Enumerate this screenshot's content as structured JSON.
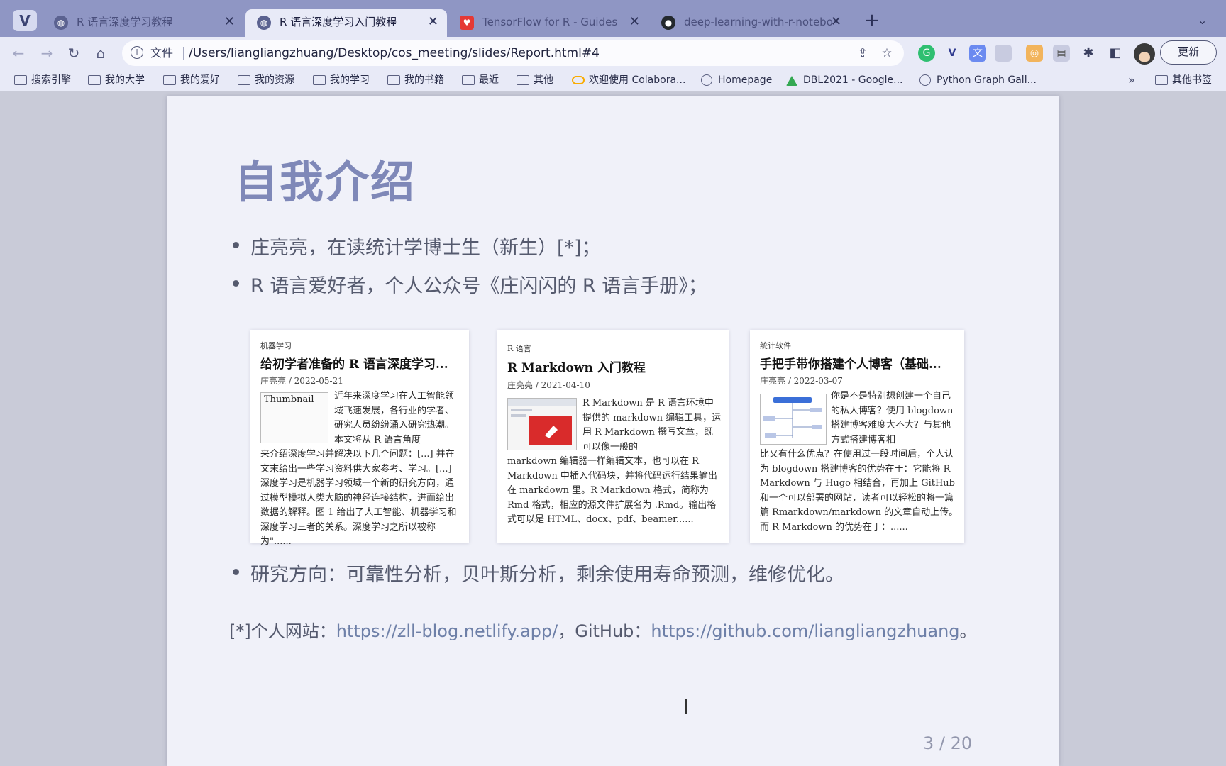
{
  "tabs": [
    {
      "title": "R 语言深度学习教程",
      "favicon": "globe-icon",
      "state": "inactive"
    },
    {
      "title": "R 语言深度学习入门教程",
      "favicon": "globe-icon",
      "state": "active"
    },
    {
      "title": "TensorFlow for R - Guides",
      "favicon": "tensorflow-icon",
      "state": "inactive"
    },
    {
      "title": "deep-learning-with-r-notebo",
      "favicon": "github-icon",
      "state": "inactive"
    }
  ],
  "toolbar": {
    "scheme_label": "文件",
    "url": "/Users/liangliangzhuang/Desktop/cos_meeting/slides/Report.html#4",
    "update_label": "更新"
  },
  "bookmarks": [
    {
      "label": "搜索引擎",
      "icon": "folder-icon"
    },
    {
      "label": "我的大学",
      "icon": "folder-icon"
    },
    {
      "label": "我的爱好",
      "icon": "folder-icon"
    },
    {
      "label": "我的资源",
      "icon": "folder-icon"
    },
    {
      "label": "我的学习",
      "icon": "folder-icon"
    },
    {
      "label": "我的书籍",
      "icon": "folder-icon"
    },
    {
      "label": "最近",
      "icon": "folder-icon"
    },
    {
      "label": "其他",
      "icon": "folder-icon"
    },
    {
      "label": "欢迎使用 Colabora...",
      "icon": "colab-icon"
    },
    {
      "label": "Homepage",
      "icon": "globe-icon"
    },
    {
      "label": "DBL2021 - Google...",
      "icon": "drive-icon"
    },
    {
      "label": "Python Graph Gall...",
      "icon": "gauge-icon"
    }
  ],
  "bookmarks_more": "»",
  "other_bookmarks": "其他书签",
  "slide": {
    "title": "自我介绍",
    "bullets": [
      "庄亮亮，在读统计学博士生（新生）[*]；",
      "R 语言爱好者，个人公众号《庄闪闪的 R 语言手册》；",
      "研究方向：可靠性分析，贝叶斯分析，剩余使用寿命预测，维修优化。"
    ],
    "cards": [
      {
        "category": "机器学习",
        "title": "给初学者准备的 R 语言深度学习...",
        "meta": "庄亮亮 / 2022-05-21",
        "thumb_alt": "Thumbnail",
        "excerpt_side": "近年来深度学习在人工智能领域飞速发展，各行业的学者、研究人员纷纷涌入研究热潮。本文将从 R 语言角度",
        "excerpt_rest": "来介绍深度学习并解决以下几个问题：[...] 并在文末给出一些学习资料供大家参考、学习。[...] 深度学习是机器学习领域一个新的研究方向，通过模型模拟人类大脑的神经连接结构，进而给出数据的解释。图 1 给出了人工智能、机器学习和深度学习三者的关系。深度学习之所以被称为\"......"
      },
      {
        "category": "R 语言",
        "title": "R Markdown 入门教程",
        "meta": "庄亮亮 / 2021-04-10",
        "excerpt_side": "R Markdown 是 R 语言环境中提供的 markdown 编辑工具，运用 R Markdown 撰写文章，既可以像一般的",
        "excerpt_rest": "markdown 编辑器一样编辑文本，也可以在 R Markdown 中插入代码块，并将代码运行结果输出在 markdown 里。R Markdown 格式，简称为 Rmd 格式，相应的源文件扩展名为 .Rmd。输出格式可以是 HTML、docx、pdf、beamer......"
      },
      {
        "category": "统计软件",
        "title": "手把手带你搭建个人博客（基础...",
        "meta": "庄亮亮 / 2022-03-07",
        "excerpt_side": "你是不是特别想创建一个自己的私人博客？使用 blogdown 搭建博客难度大不大？与其他方式搭建博客相",
        "excerpt_rest": "比又有什么优点？在使用过一段时间后，个人认为 blogdown 搭建博客的优势在于：它能将 R Markdown 与 Hugo 相结合，再加上 GitHub 和一个可以部署的网站，读者可以轻松的将一篇篇 Rmarkdown/markdown 的文章自动上传。而 R Markdown 的优势在于：......"
      }
    ],
    "footnote_prefix": "[*]个人网站：",
    "footnote_site": "https://zll-blog.netlify.app/",
    "footnote_mid": "，GitHub：",
    "footnote_github": "https://github.com/liangliangzhuang",
    "footnote_end": "。",
    "page": "3 / 20"
  },
  "colors": {
    "tab_strip": "#8f96c4",
    "toolbar": "#e8eaf7",
    "slide_title": "#7f88b8",
    "link": "#6e80a8"
  }
}
